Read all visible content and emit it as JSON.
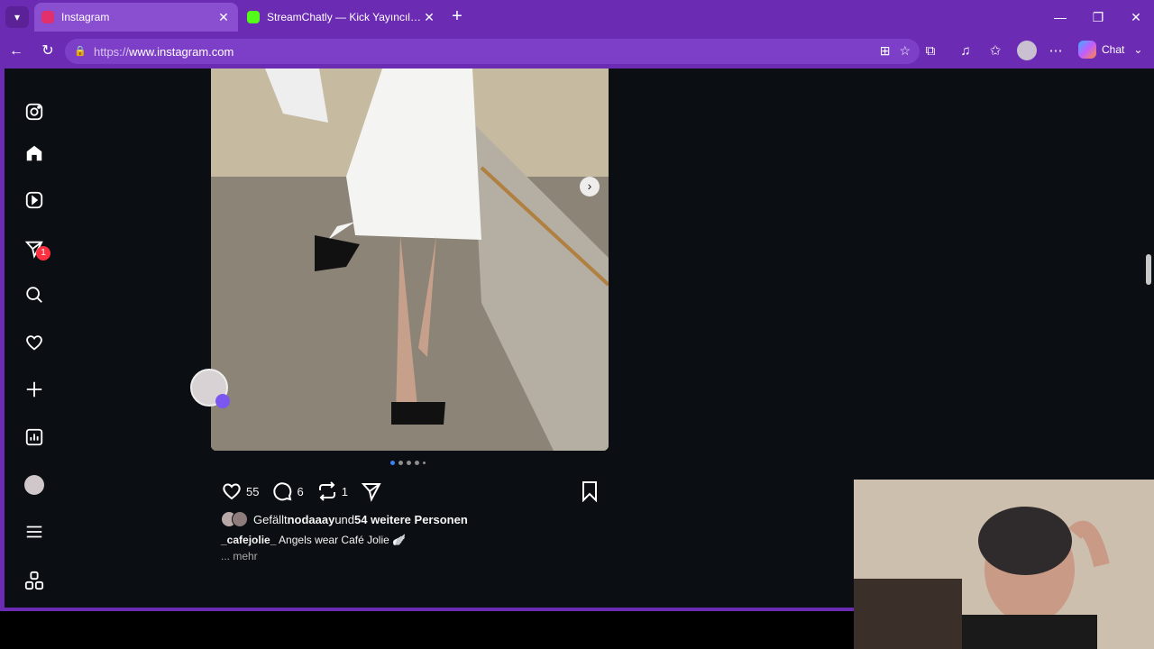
{
  "browser": {
    "tabs": [
      {
        "title": "Instagram",
        "favicon_color": "#e1306c",
        "active": true
      },
      {
        "title": "StreamChatly — Kick Yayıncıları için",
        "favicon_color": "#53fc18",
        "active": false
      }
    ],
    "address": {
      "protocol": "https://",
      "host": "www.instagram.com"
    },
    "copilot_label": "Chat"
  },
  "sidebar": {
    "icons": [
      "instagram-logo-icon",
      "home-icon",
      "reels-icon",
      "messages-icon",
      "search-icon",
      "notifications-icon",
      "create-icon",
      "dashboard-icon",
      "profile-icon",
      "menu-icon",
      "also-from-meta-icon"
    ],
    "messages_badge": "1"
  },
  "post": {
    "carousel_position": {
      "current": 1,
      "total": 5
    },
    "likes_count": "55",
    "comments_count": "6",
    "reposts_count": "1",
    "liked_by_prefix": "Gefällt ",
    "liked_by_user": "nodaaay",
    "liked_by_join": " und ",
    "liked_by_others": "54 weitere Personen",
    "caption_user": "_cafejolie_",
    "caption_text": " Angels wear Café Jolie 🪽",
    "more_label": "... mehr"
  },
  "colors": {
    "browser_accent": "#6b2bb3",
    "page_bg": "#0b0e12",
    "badge": "#ff3040"
  }
}
